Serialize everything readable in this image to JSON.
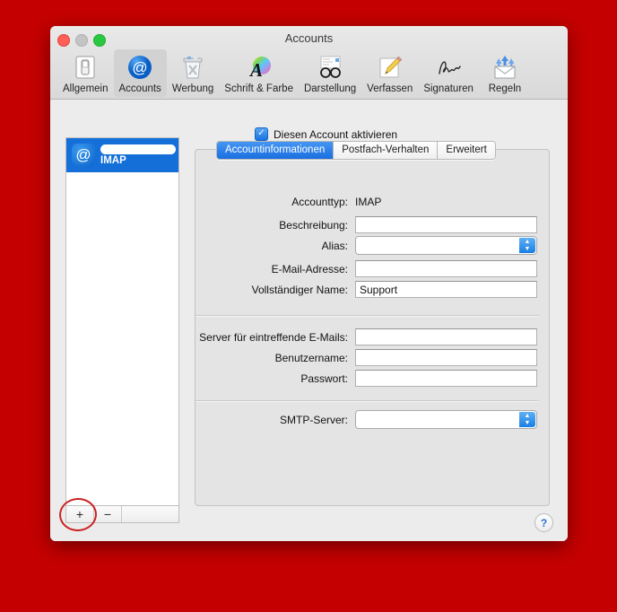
{
  "window": {
    "title": "Accounts",
    "traffic_lights": [
      "close",
      "minimize",
      "maximize"
    ]
  },
  "toolbar": {
    "items": [
      {
        "label": "Allgemein",
        "icon": "general-icon",
        "selected": false
      },
      {
        "label": "Accounts",
        "icon": "at-sign-icon",
        "selected": true
      },
      {
        "label": "Werbung",
        "icon": "junk-bin-icon",
        "selected": false
      },
      {
        "label": "Schrift & Farbe",
        "icon": "font-color-icon",
        "selected": false
      },
      {
        "label": "Darstellung",
        "icon": "viewing-icon",
        "selected": false
      },
      {
        "label": "Verfassen",
        "icon": "compose-icon",
        "selected": false
      },
      {
        "label": "Signaturen",
        "icon": "signature-icon",
        "selected": false
      },
      {
        "label": "Regeln",
        "icon": "rules-icon",
        "selected": false
      }
    ]
  },
  "sidebar": {
    "accounts": [
      {
        "name": "",
        "name_redacted": true,
        "type": "IMAP",
        "icon": "at-sign-icon",
        "selected": true
      }
    ],
    "footer": {
      "add_label": "+",
      "remove_label": "−"
    },
    "annotation": {
      "shape": "ellipse",
      "color": "#cc2121",
      "target": "add-account-button"
    }
  },
  "tabs": [
    {
      "label": "Accountinformationen",
      "active": true
    },
    {
      "label": "Postfach-Verhalten",
      "active": false
    },
    {
      "label": "Erweitert",
      "active": false
    }
  ],
  "form": {
    "enable_account": {
      "label": "Diesen Account aktivieren",
      "checked": true,
      "check_glyph": "✓"
    },
    "fields": [
      {
        "label": "Accounttyp:",
        "value": "IMAP",
        "kind": "static"
      },
      {
        "label": "Beschreibung:",
        "value": "",
        "kind": "text"
      },
      {
        "label": "Alias:",
        "value": "",
        "kind": "combo"
      },
      {
        "label": "E-Mail-Adresse:",
        "value": "",
        "kind": "text"
      },
      {
        "label": "Vollständiger Name:",
        "value": "Support",
        "kind": "text"
      },
      {
        "label": "Server für eintreffende E-Mails:",
        "value": "",
        "kind": "text"
      },
      {
        "label": "Benutzername:",
        "value": "",
        "kind": "text"
      },
      {
        "label": "Passwort:",
        "value": "",
        "kind": "text"
      },
      {
        "label": "SMTP-Server:",
        "value": "",
        "kind": "combo"
      }
    ]
  },
  "help": {
    "label": "?"
  },
  "colors": {
    "desktop_background": "#c50000",
    "accent_blue": "#1470d8",
    "annotation_red": "#cc2121",
    "window_chrome": "#ececec",
    "panel": "#e4e4e4"
  }
}
